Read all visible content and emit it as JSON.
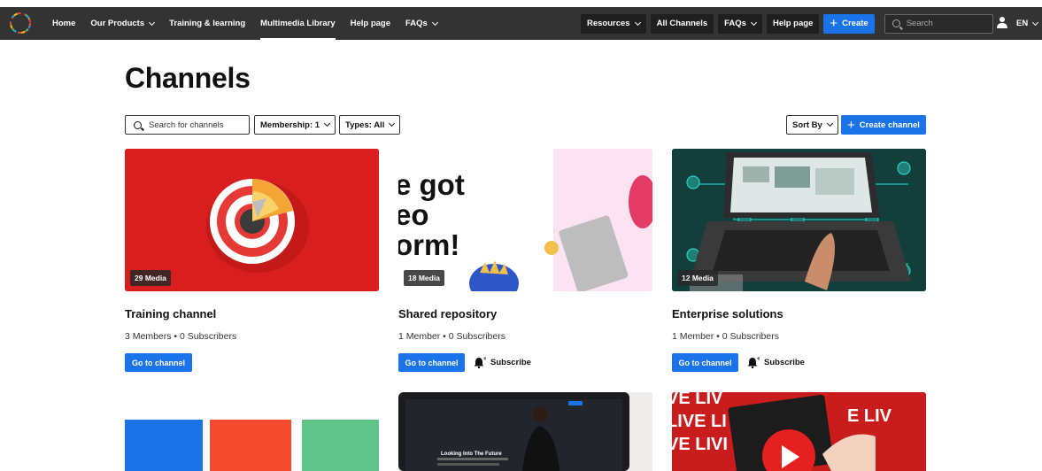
{
  "nav": {
    "left_items": [
      {
        "label": "Home"
      },
      {
        "label": "Our Products"
      },
      {
        "label": "Training & learning"
      },
      {
        "label": "Multimedia Library"
      },
      {
        "label": "Help page"
      },
      {
        "label": "FAQs"
      }
    ],
    "right_items": [
      {
        "label": "Resources"
      },
      {
        "label": "All Channels"
      },
      {
        "label": "FAQs"
      },
      {
        "label": "Help page"
      }
    ],
    "create_label": "Create",
    "search_placeholder": "Search",
    "language": "EN",
    "accent_color": "#1a73e8"
  },
  "page": {
    "title": "Channels",
    "search_placeholder": "Search for channels",
    "membership_filter": "Membership: 1",
    "types_filter": "Types: All",
    "sort_label": "Sort By",
    "create_channel_label": "Create channel"
  },
  "channels": [
    {
      "media_count": "29 Media",
      "title": "Training channel",
      "members": "3 Members",
      "subscribers": "0 Subscribers",
      "go_label": "Go to channel"
    },
    {
      "media_count": "18 Media",
      "title": "Shared repository",
      "members": "1 Member",
      "subscribers": "0 Subscribers",
      "go_label": "Go to channel",
      "subscribe_label": "Subscribe",
      "image_text": [
        "e got",
        "eo",
        "orm!"
      ]
    },
    {
      "media_count": "12 Media",
      "title": "Enterprise solutions",
      "members": "1 Member",
      "subscribers": "0 Subscribers",
      "go_label": "Go to channel",
      "subscribe_label": "Subscribe"
    }
  ],
  "second_row": {
    "video_slide_title": "Looking Into The Future",
    "live_text": [
      "VE LIV",
      "LIVE LI",
      "VE LIVI",
      "E LIV"
    ]
  }
}
